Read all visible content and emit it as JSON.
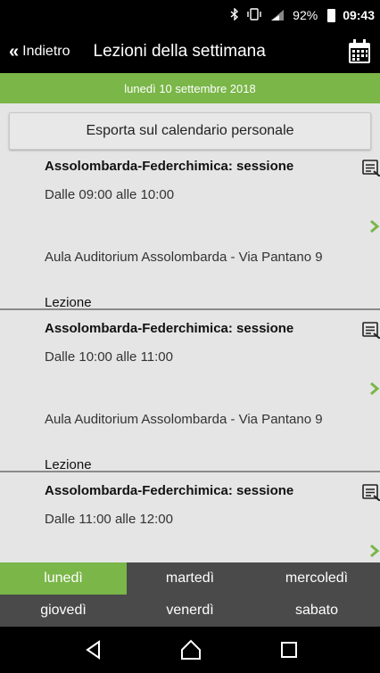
{
  "status_bar": {
    "bluetooth_icon": "bluetooth-icon",
    "vibrate_icon": "vibrate-icon",
    "signal_icon": "lte-signal-icon",
    "battery": "92%",
    "time": "09:43"
  },
  "app_bar": {
    "back_label": "Indietro",
    "title": "Lezioni della settimana",
    "calendar_icon": "calendar-icon"
  },
  "date_banner": "lunedì 10 settembre 2018",
  "export_label": "Esporta sul calendario personale",
  "lessons": [
    {
      "title": "Assolombarda-Federchimica: sessione",
      "time": "Dalle 09:00 alle 10:00",
      "room": "Aula Auditorium Assolombarda - Via Pantano 9",
      "kind": "Lezione"
    },
    {
      "title": "Assolombarda-Federchimica: sessione",
      "time": "Dalle 10:00 alle 11:00",
      "room": "Aula Auditorium Assolombarda - Via Pantano 9",
      "kind": "Lezione"
    },
    {
      "title": "Assolombarda-Federchimica: sessione",
      "time": "Dalle 11:00 alle 12:00",
      "room": "",
      "kind": ""
    }
  ],
  "day_tabs": [
    {
      "label": "lunedì",
      "active": true
    },
    {
      "label": "martedì",
      "active": false
    },
    {
      "label": "mercoledì",
      "active": false
    },
    {
      "label": "giovedì",
      "active": false
    },
    {
      "label": "venerdì",
      "active": false
    },
    {
      "label": "sabato",
      "active": false
    }
  ],
  "colors": {
    "accent_green": "#7ab648",
    "tab_bar": "#4a4a4a",
    "list_bg": "#e5e5e5"
  }
}
